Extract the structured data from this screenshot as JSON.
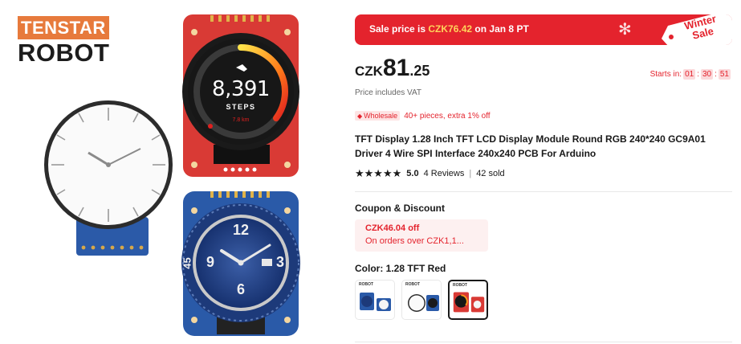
{
  "brand": {
    "top": "TENSTAR",
    "bottom": "ROBOT"
  },
  "product_image": {
    "top_module": {
      "value": "8,391",
      "label": "STEPS",
      "distance": "7.8 km"
    },
    "dive_watch": {
      "numerals": [
        "12",
        "6",
        "9",
        "3"
      ],
      "bezel": [
        "45"
      ]
    }
  },
  "sale_banner": {
    "prefix": "Sale price is ",
    "price": "CZK76.42",
    "suffix": " on Jan 8 PT",
    "tag_line1": "Winter",
    "tag_line2": "Sale"
  },
  "price": {
    "currency": "CZK",
    "integer": "81",
    "decimal": ".25"
  },
  "countdown": {
    "label": "Starts in:",
    "hours": "01",
    "minutes": "30",
    "seconds": "51",
    "separator": ":"
  },
  "vat_note": "Price includes VAT",
  "wholesale": {
    "badge": "Wholesale",
    "text": "40+ pieces, extra 1% off"
  },
  "title": "TFT Display 1.28 Inch TFT LCD Display Module Round RGB 240*240 GC9A01 Driver 4 Wire SPI Interface 240x240 PCB For Arduino",
  "rating": {
    "stars": "★★★★★",
    "value": "5.0",
    "reviews": "4 Reviews",
    "separator": "|",
    "sold": "42 sold"
  },
  "coupon": {
    "heading": "Coupon & Discount",
    "amount": "CZK46.04 off",
    "condition": "On orders over CZK1,1..."
  },
  "color": {
    "label": "Color: ",
    "selected": "1.28 TFT Red",
    "swatch_logo": "ROBOT",
    "options": [
      "1.28 TFT Blue",
      "1.28 TFT White",
      "1.28 TFT Red"
    ]
  },
  "colors": {
    "accent_red": "#e4232d",
    "brand_orange": "#e77a3c",
    "board_red": "#d93a35",
    "board_blue": "#2a5aa8"
  }
}
